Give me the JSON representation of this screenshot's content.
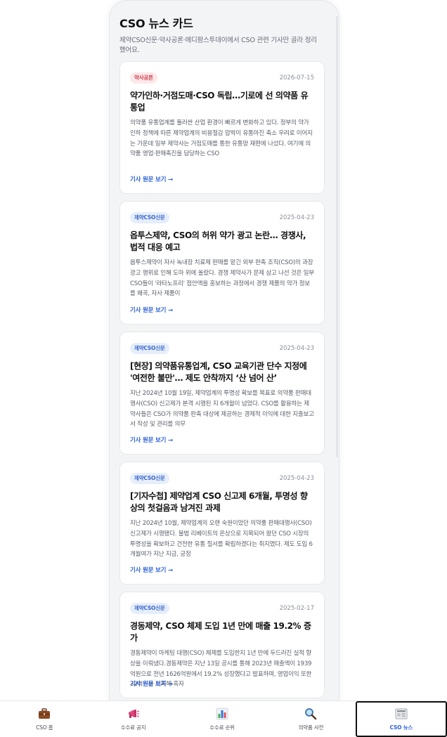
{
  "header": {
    "title": "CSO 뉴스 카드",
    "subtitle": "제약CSO신문·약사공론·메디팜스투데이에서 CSO 관련 기사만 골라 정리했어요."
  },
  "cards": [
    {
      "source": "약사공론",
      "date": "2026-07-15",
      "title": "약가인하·거점도매·CSO 독립…기로에 선 의약품 유통업",
      "body": "의약품 유통업계를 둘러싼 산업 환경이 빠르게 변화하고 있다. 정부의 약가인하 정책에 따른 제약업계의 비용절감 압박이 유통마진 축소 우려로 이어지는 가운데 일부 제약사는 거점도매를 통한 유통망 재편에 나섰다. 여기에 의약품 영업·판매촉진을 담당하는 CSO",
      "link": "기사 원문 보기 →"
    },
    {
      "source": "제약CSO신문",
      "date": "2025-04-23",
      "title": "옵투스제약, CSO의 허위 약가 광고 논란… 경쟁사, 법적 대응 예고",
      "body": "옵투스제약이 자사 녹내장 치료제 판매를 맡긴 외부 판촉 조직(CSO)의 과장 광고 행위로 인해 도마 위에 올랐다. 경쟁 제약사가 문제 삼고 나선 것은 일부 CSO들이 '라타노프리' 점안액을 홍보하는 과정에서 경쟁 제품의 약가 정보를 왜곡, 자사 제품이",
      "link": "기사 원문 보기 →"
    },
    {
      "source": "제약CSO신문",
      "date": "2025-04-23",
      "title": "[현장] 의약품유통업계, CSO 교육기관 단수 지정에 '여전한 불만'… 제도 안착까지 ‘산 넘어 산’",
      "body": "지난 2024년 10월 19일, 제약업계의 투명성 확보를 목표로 의약품 판매대행사(CSO) 신고제가 본격 시행된 지 6개월이 넘었다. CSO를 활용하는 제약사들은 CSO가 의약품 판촉 대상에 제공하는 경제적 이익에 대한 지출보고서 작성 및 관리를 의무",
      "link": "기사 원문 보기 →"
    },
    {
      "source": "제약CSO신문",
      "date": "2025-04-23",
      "title": "[기자수첩] 제약업계 CSO 신고제 6개월, 투명성 향상의 첫걸음과 남겨진 과제",
      "body": "지난 2024년 10월, 제약업계의 오랜 숙원이었던 의약품 판매대행사(CSO) 신고제가 시행됐다. 불법 리베이트의 온상으로 지목되어 왔던 CSO 시장의 투명성을 확보하고 건전한 유통 질서를 확립하겠다는 취지였다. 제도 도입 6개월여가 지난 지금, 긍정",
      "link": "기사 원문 보기 →"
    },
    {
      "source": "제약CSO신문",
      "date": "2025-02-17",
      "title": "경동제약, CSO 체제 도입 1년 만에 매출 19.2% 증가",
      "body": "경동제약이 마케팅 대행(CSO) 체제를 도입한지 1년 만에 두드러진 실적 향상을 이뤄냈다.경동제약은 지난 13일 공시를 통해 2023년 매출액이 1939억원으로 전년 1626억원에서 19.2% 성장했다고 발표하며, 영업이익 또한 32억원을 기록해 흑자",
      "link": "기사 원문 보기 →"
    }
  ],
  "nav": [
    {
      "label": "CSO 홈",
      "icon": "briefcase-icon"
    },
    {
      "label": "수수료 공지",
      "icon": "megaphone-icon"
    },
    {
      "label": "수수료 순위",
      "icon": "bar-chart-icon"
    },
    {
      "label": "의약품 사전",
      "icon": "magnifier-icon"
    },
    {
      "label": "CSO 뉴스",
      "icon": "newspaper-icon",
      "active": true
    }
  ],
  "colors": {
    "accent": "#2f64d6",
    "badge_red_bg": "#fde8ea",
    "badge_red_text": "#d2434f",
    "badge_blue_bg": "#e6eefc",
    "badge_blue_text": "#3b68c9"
  }
}
